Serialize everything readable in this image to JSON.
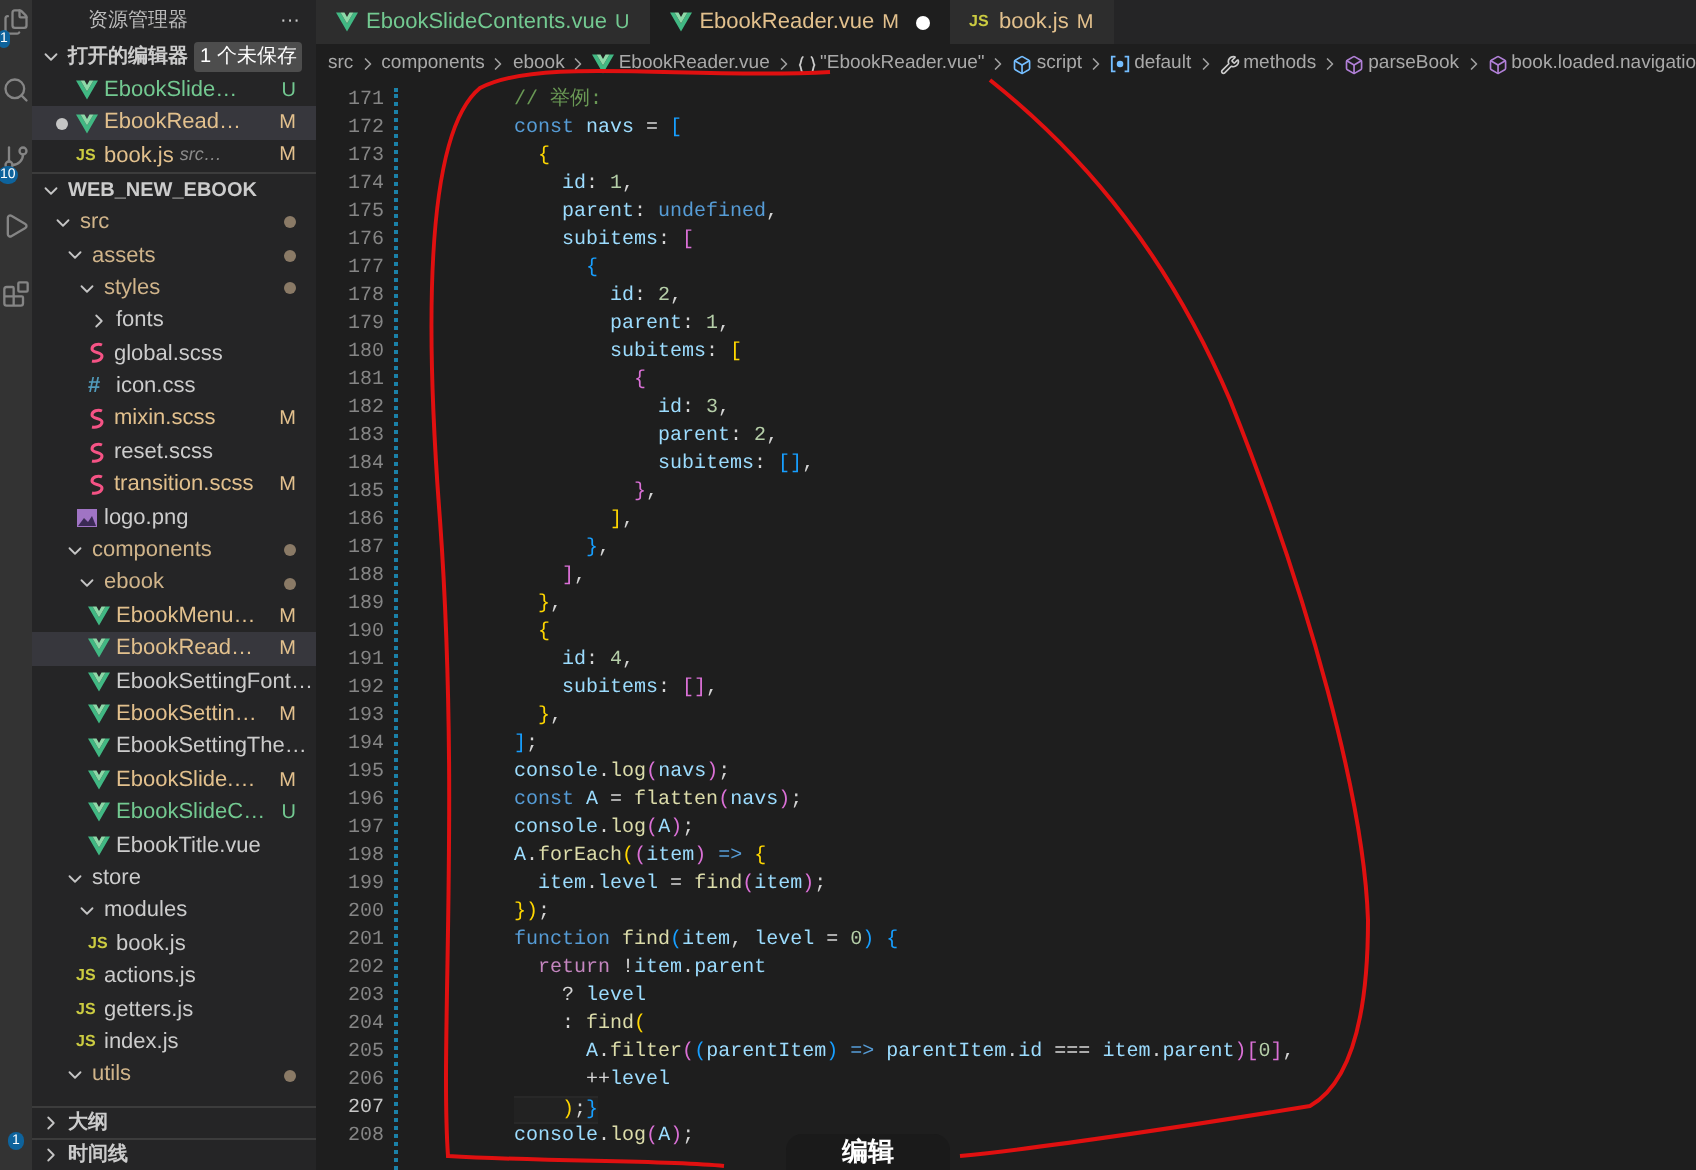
{
  "activity_bar": {
    "badges": [
      "1",
      "10",
      "1"
    ]
  },
  "explorer": {
    "title": "资源管理器",
    "more": "···",
    "open_editors": {
      "title": "打开的编辑器",
      "badge": "1 个未保存",
      "expanded": true,
      "items": [
        {
          "name": "EbookSlide…",
          "kind": "vue",
          "status": "U",
          "unsaved": false,
          "selected": false
        },
        {
          "name": "EbookRead…",
          "kind": "vue",
          "status": "M",
          "unsaved": true,
          "selected": true
        },
        {
          "name": "book.js",
          "description": "src…",
          "kind": "js",
          "icon_label": "JS",
          "status": "M",
          "unsaved": false,
          "selected": false
        }
      ]
    },
    "project": {
      "title": "WEB_NEW_EBOOK",
      "expanded": true,
      "tree": [
        {
          "name": "src",
          "kind": "folder",
          "expanded": true,
          "modified": true,
          "selected": false,
          "children": [
            {
              "name": "assets",
              "kind": "folder",
              "expanded": true,
              "modified": true,
              "selected": false,
              "children": [
                {
                  "name": "styles",
                  "kind": "folder",
                  "expanded": true,
                  "modified": true,
                  "selected": false,
                  "children": [
                    {
                      "name": "fonts",
                      "kind": "folder",
                      "expanded": false,
                      "modified": false,
                      "selected": false
                    },
                    {
                      "name": "global.scss",
                      "kind": "scss",
                      "selected": false
                    },
                    {
                      "name": "icon.css",
                      "kind": "css",
                      "icon_label": "#",
                      "selected": false
                    },
                    {
                      "name": "mixin.scss",
                      "kind": "scss",
                      "status": "M",
                      "selected": false
                    },
                    {
                      "name": "reset.scss",
                      "kind": "scss",
                      "selected": false
                    },
                    {
                      "name": "transition.scss",
                      "kind": "scss",
                      "status": "M",
                      "selected": false
                    }
                  ]
                },
                {
                  "name": "logo.png",
                  "kind": "png",
                  "selected": false
                }
              ]
            },
            {
              "name": "components",
              "kind": "folder",
              "expanded": true,
              "modified": true,
              "selected": false,
              "children": [
                {
                  "name": "ebook",
                  "kind": "folder",
                  "expanded": true,
                  "modified": true,
                  "selected": false,
                  "children": [
                    {
                      "name": "EbookMenu…",
                      "kind": "vue",
                      "status": "M",
                      "selected": false
                    },
                    {
                      "name": "EbookRead…",
                      "kind": "vue",
                      "status": "M",
                      "selected": true
                    },
                    {
                      "name": "EbookSettingFont…",
                      "kind": "vue",
                      "selected": false
                    },
                    {
                      "name": "EbookSettin…",
                      "kind": "vue",
                      "status": "M",
                      "selected": false
                    },
                    {
                      "name": "EbookSettingThe…",
                      "kind": "vue",
                      "selected": false
                    },
                    {
                      "name": "EbookSlide.…",
                      "kind": "vue",
                      "status": "M",
                      "selected": false
                    },
                    {
                      "name": "EbookSlideC…",
                      "kind": "vue",
                      "status": "U",
                      "selected": false
                    },
                    {
                      "name": "EbookTitle.vue",
                      "kind": "vue",
                      "selected": false
                    }
                  ]
                }
              ]
            },
            {
              "name": "store",
              "kind": "folder",
              "expanded": true,
              "modified": false,
              "selected": false,
              "children": [
                {
                  "name": "modules",
                  "kind": "folder",
                  "expanded": true,
                  "modified": false,
                  "selected": false,
                  "children": [
                    {
                      "name": "book.js",
                      "kind": "js",
                      "icon_label": "JS",
                      "selected": false
                    }
                  ]
                },
                {
                  "name": "actions.js",
                  "kind": "js",
                  "icon_label": "JS",
                  "selected": false
                },
                {
                  "name": "getters.js",
                  "kind": "js",
                  "icon_label": "JS",
                  "selected": false
                },
                {
                  "name": "index.js",
                  "kind": "js",
                  "icon_label": "JS",
                  "selected": false
                }
              ]
            },
            {
              "name": "utils",
              "kind": "folder",
              "expanded": true,
              "modified": true,
              "selected": false
            }
          ]
        }
      ]
    },
    "sections": [
      {
        "title": "大纲",
        "expanded": false
      },
      {
        "title": "时间线",
        "expanded": false
      }
    ]
  },
  "tabs": [
    {
      "label": "EbookSlideContents.vue",
      "kind": "vue",
      "status": "U",
      "unsaved": false,
      "selected": false
    },
    {
      "label": "EbookReader.vue",
      "kind": "vue",
      "status": "M",
      "unsaved": true,
      "selected": true
    },
    {
      "label": "book.js",
      "kind": "js",
      "icon_label": "JS",
      "status": "M",
      "unsaved": false,
      "selected": false
    }
  ],
  "breadcrumb": [
    {
      "label": "src",
      "kind": "text"
    },
    {
      "label": "components",
      "kind": "text"
    },
    {
      "label": "ebook",
      "kind": "text"
    },
    {
      "label": "EbookReader.vue",
      "kind": "vue"
    },
    {
      "label": "\"EbookReader.vue\"",
      "kind": "braces"
    },
    {
      "label": "script",
      "kind": "cube"
    },
    {
      "label": "default",
      "kind": "field"
    },
    {
      "label": "methods",
      "kind": "wrench"
    },
    {
      "label": "parseBook",
      "kind": "method"
    },
    {
      "label": "book.loaded.navigatio",
      "kind": "method"
    }
  ],
  "code": [
    {
      "number": "171",
      "current": false,
      "tokens": [
        {
          "text": "// 举例:",
          "kind": "comment"
        }
      ]
    },
    {
      "number": "172",
      "current": false,
      "tokens": [
        {
          "text": "const ",
          "kind": "keyword"
        },
        {
          "text": "navs",
          "kind": "variable"
        },
        {
          "text": " = ",
          "kind": "punct"
        },
        {
          "text": "[",
          "kind": "blue"
        }
      ]
    },
    {
      "number": "173",
      "current": false,
      "tokens": [
        {
          "text": "  {",
          "kind": "gold"
        }
      ]
    },
    {
      "number": "174",
      "current": false,
      "tokens": [
        {
          "text": "    id",
          "kind": "variable"
        },
        {
          "text": ": ",
          "kind": "punct"
        },
        {
          "text": "1",
          "kind": "number"
        },
        {
          "text": ",",
          "kind": "punct"
        }
      ]
    },
    {
      "number": "175",
      "current": false,
      "tokens": [
        {
          "text": "    parent",
          "kind": "variable"
        },
        {
          "text": ": ",
          "kind": "punct"
        },
        {
          "text": "undefined",
          "kind": "keyword"
        },
        {
          "text": ",",
          "kind": "punct"
        }
      ]
    },
    {
      "number": "176",
      "current": false,
      "tokens": [
        {
          "text": "    subitems",
          "kind": "variable"
        },
        {
          "text": ": ",
          "kind": "punct"
        },
        {
          "text": "[",
          "kind": "magenta"
        }
      ]
    },
    {
      "number": "177",
      "current": false,
      "tokens": [
        {
          "text": "      {",
          "kind": "blue"
        }
      ]
    },
    {
      "number": "178",
      "current": false,
      "tokens": [
        {
          "text": "        id",
          "kind": "variable"
        },
        {
          "text": ": ",
          "kind": "punct"
        },
        {
          "text": "2",
          "kind": "number"
        },
        {
          "text": ",",
          "kind": "punct"
        }
      ]
    },
    {
      "number": "179",
      "current": false,
      "tokens": [
        {
          "text": "        parent",
          "kind": "variable"
        },
        {
          "text": ": ",
          "kind": "punct"
        },
        {
          "text": "1",
          "kind": "number"
        },
        {
          "text": ",",
          "kind": "punct"
        }
      ]
    },
    {
      "number": "180",
      "current": false,
      "tokens": [
        {
          "text": "        subitems",
          "kind": "variable"
        },
        {
          "text": ": ",
          "kind": "punct"
        },
        {
          "text": "[",
          "kind": "gold"
        }
      ]
    },
    {
      "number": "181",
      "current": false,
      "tokens": [
        {
          "text": "          {",
          "kind": "magenta"
        }
      ]
    },
    {
      "number": "182",
      "current": false,
      "tokens": [
        {
          "text": "            id",
          "kind": "variable"
        },
        {
          "text": ": ",
          "kind": "punct"
        },
        {
          "text": "3",
          "kind": "number"
        },
        {
          "text": ",",
          "kind": "punct"
        }
      ]
    },
    {
      "number": "183",
      "current": false,
      "tokens": [
        {
          "text": "            parent",
          "kind": "variable"
        },
        {
          "text": ": ",
          "kind": "punct"
        },
        {
          "text": "2",
          "kind": "number"
        },
        {
          "text": ",",
          "kind": "punct"
        }
      ]
    },
    {
      "number": "184",
      "current": false,
      "tokens": [
        {
          "text": "            subitems",
          "kind": "variable"
        },
        {
          "text": ": ",
          "kind": "punct"
        },
        {
          "text": "[]",
          "kind": "blue"
        },
        {
          "text": ",",
          "kind": "punct"
        }
      ]
    },
    {
      "number": "185",
      "current": false,
      "tokens": [
        {
          "text": "          }",
          "kind": "magenta"
        },
        {
          "text": ",",
          "kind": "punct"
        }
      ]
    },
    {
      "number": "186",
      "current": false,
      "tokens": [
        {
          "text": "        ]",
          "kind": "gold"
        },
        {
          "text": ",",
          "kind": "punct"
        }
      ]
    },
    {
      "number": "187",
      "current": false,
      "tokens": [
        {
          "text": "      }",
          "kind": "blue"
        },
        {
          "text": ",",
          "kind": "punct"
        }
      ]
    },
    {
      "number": "188",
      "current": false,
      "tokens": [
        {
          "text": "    ]",
          "kind": "magenta"
        },
        {
          "text": ",",
          "kind": "punct"
        }
      ]
    },
    {
      "number": "189",
      "current": false,
      "tokens": [
        {
          "text": "  }",
          "kind": "gold"
        },
        {
          "text": ",",
          "kind": "punct"
        }
      ]
    },
    {
      "number": "190",
      "current": false,
      "tokens": [
        {
          "text": "  {",
          "kind": "gold"
        }
      ]
    },
    {
      "number": "191",
      "current": false,
      "tokens": [
        {
          "text": "    id",
          "kind": "variable"
        },
        {
          "text": ": ",
          "kind": "punct"
        },
        {
          "text": "4",
          "kind": "number"
        },
        {
          "text": ",",
          "kind": "punct"
        }
      ]
    },
    {
      "number": "192",
      "current": false,
      "tokens": [
        {
          "text": "    subitems",
          "kind": "variable"
        },
        {
          "text": ": ",
          "kind": "punct"
        },
        {
          "text": "[]",
          "kind": "magenta"
        },
        {
          "text": ",",
          "kind": "punct"
        }
      ]
    },
    {
      "number": "193",
      "current": false,
      "tokens": [
        {
          "text": "  }",
          "kind": "gold"
        },
        {
          "text": ",",
          "kind": "punct"
        }
      ]
    },
    {
      "number": "194",
      "current": false,
      "tokens": [
        {
          "text": "]",
          "kind": "blue"
        },
        {
          "text": ";",
          "kind": "punct"
        }
      ]
    },
    {
      "number": "195",
      "current": false,
      "tokens": [
        {
          "text": "console",
          "kind": "variable"
        },
        {
          "text": ".",
          "kind": "punct"
        },
        {
          "text": "log",
          "kind": "function"
        },
        {
          "text": "(",
          "kind": "magenta"
        },
        {
          "text": "navs",
          "kind": "variable"
        },
        {
          "text": ")",
          "kind": "magenta"
        },
        {
          "text": ";",
          "kind": "punct"
        }
      ]
    },
    {
      "number": "196",
      "current": false,
      "tokens": [
        {
          "text": "const ",
          "kind": "keyword"
        },
        {
          "text": "A",
          "kind": "variable"
        },
        {
          "text": " = ",
          "kind": "punct"
        },
        {
          "text": "flatten",
          "kind": "function"
        },
        {
          "text": "(",
          "kind": "magenta"
        },
        {
          "text": "navs",
          "kind": "variable"
        },
        {
          "text": ")",
          "kind": "magenta"
        },
        {
          "text": ";",
          "kind": "punct"
        }
      ]
    },
    {
      "number": "197",
      "current": false,
      "tokens": [
        {
          "text": "console",
          "kind": "variable"
        },
        {
          "text": ".",
          "kind": "punct"
        },
        {
          "text": "log",
          "kind": "function"
        },
        {
          "text": "(",
          "kind": "magenta"
        },
        {
          "text": "A",
          "kind": "variable"
        },
        {
          "text": ")",
          "kind": "magenta"
        },
        {
          "text": ";",
          "kind": "punct"
        }
      ]
    },
    {
      "number": "198",
      "current": false,
      "tokens": [
        {
          "text": "A",
          "kind": "variable"
        },
        {
          "text": ".",
          "kind": "punct"
        },
        {
          "text": "forEach",
          "kind": "function"
        },
        {
          "text": "(",
          "kind": "gold"
        },
        {
          "text": "(",
          "kind": "magenta"
        },
        {
          "text": "item",
          "kind": "variable"
        },
        {
          "text": ")",
          "kind": "magenta"
        },
        {
          "text": " => ",
          "kind": "keyword"
        },
        {
          "text": "{",
          "kind": "gold"
        }
      ]
    },
    {
      "number": "199",
      "current": false,
      "tokens": [
        {
          "text": "  item",
          "kind": "variable"
        },
        {
          "text": ".",
          "kind": "punct"
        },
        {
          "text": "level",
          "kind": "variable"
        },
        {
          "text": " = ",
          "kind": "punct"
        },
        {
          "text": "find",
          "kind": "function"
        },
        {
          "text": "(",
          "kind": "magenta"
        },
        {
          "text": "item",
          "kind": "variable"
        },
        {
          "text": ")",
          "kind": "magenta"
        },
        {
          "text": ";",
          "kind": "punct"
        }
      ]
    },
    {
      "number": "200",
      "current": false,
      "tokens": [
        {
          "text": "}",
          "kind": "gold"
        },
        {
          "text": ")",
          "kind": "gold"
        },
        {
          "text": ";",
          "kind": "punct"
        }
      ]
    },
    {
      "number": "201",
      "current": false,
      "tokens": [
        {
          "text": "function ",
          "kind": "keyword"
        },
        {
          "text": "find",
          "kind": "function"
        },
        {
          "text": "(",
          "kind": "blue"
        },
        {
          "text": "item",
          "kind": "variable"
        },
        {
          "text": ", ",
          "kind": "punct"
        },
        {
          "text": "level",
          "kind": "variable"
        },
        {
          "text": " = ",
          "kind": "punct"
        },
        {
          "text": "0",
          "kind": "number"
        },
        {
          "text": ")",
          "kind": "blue"
        },
        {
          "text": " {",
          "kind": "blue"
        }
      ]
    },
    {
      "number": "202",
      "current": false,
      "tokens": [
        {
          "text": "  return",
          "kind": "control"
        },
        {
          "text": " !",
          "kind": "punct"
        },
        {
          "text": "item",
          "kind": "variable"
        },
        {
          "text": ".",
          "kind": "punct"
        },
        {
          "text": "parent",
          "kind": "variable"
        }
      ]
    },
    {
      "number": "203",
      "current": false,
      "tokens": [
        {
          "text": "    ? ",
          "kind": "punct"
        },
        {
          "text": "level",
          "kind": "variable"
        }
      ]
    },
    {
      "number": "204",
      "current": false,
      "tokens": [
        {
          "text": "    : ",
          "kind": "punct"
        },
        {
          "text": "find",
          "kind": "function"
        },
        {
          "text": "(",
          "kind": "gold"
        }
      ]
    },
    {
      "number": "205",
      "current": false,
      "tokens": [
        {
          "text": "      A",
          "kind": "variable"
        },
        {
          "text": ".",
          "kind": "punct"
        },
        {
          "text": "filter",
          "kind": "function"
        },
        {
          "text": "(",
          "kind": "magenta"
        },
        {
          "text": "(",
          "kind": "blue"
        },
        {
          "text": "parentItem",
          "kind": "variable"
        },
        {
          "text": ")",
          "kind": "blue"
        },
        {
          "text": " => ",
          "kind": "keyword"
        },
        {
          "text": "parentItem",
          "kind": "variable"
        },
        {
          "text": ".",
          "kind": "punct"
        },
        {
          "text": "id",
          "kind": "variable"
        },
        {
          "text": " === ",
          "kind": "punct"
        },
        {
          "text": "item",
          "kind": "variable"
        },
        {
          "text": ".",
          "kind": "punct"
        },
        {
          "text": "parent",
          "kind": "variable"
        },
        {
          "text": ")",
          "kind": "magenta"
        },
        {
          "text": "[",
          "kind": "magenta"
        },
        {
          "text": "0",
          "kind": "number"
        },
        {
          "text": "]",
          "kind": "magenta"
        },
        {
          "text": ",",
          "kind": "punct"
        }
      ]
    },
    {
      "number": "206",
      "current": false,
      "tokens": [
        {
          "text": "      ++",
          "kind": "punct"
        },
        {
          "text": "level",
          "kind": "variable"
        }
      ]
    },
    {
      "number": "207",
      "current": true,
      "tokens": [
        {
          "text": "    )",
          "kind": "gold"
        },
        {
          "text": ";",
          "kind": "punct"
        },
        {
          "text": "}",
          "kind": "blue"
        }
      ]
    },
    {
      "number": "208",
      "current": false,
      "tokens": [
        {
          "text": "console",
          "kind": "variable"
        },
        {
          "text": ".",
          "kind": "punct"
        },
        {
          "text": "log",
          "kind": "function"
        },
        {
          "text": "(",
          "kind": "magenta"
        },
        {
          "text": "A",
          "kind": "variable"
        },
        {
          "text": ")",
          "kind": "magenta"
        },
        {
          "text": ";",
          "kind": "punct"
        }
      ]
    }
  ],
  "edit_popup": {
    "label": "编辑"
  }
}
